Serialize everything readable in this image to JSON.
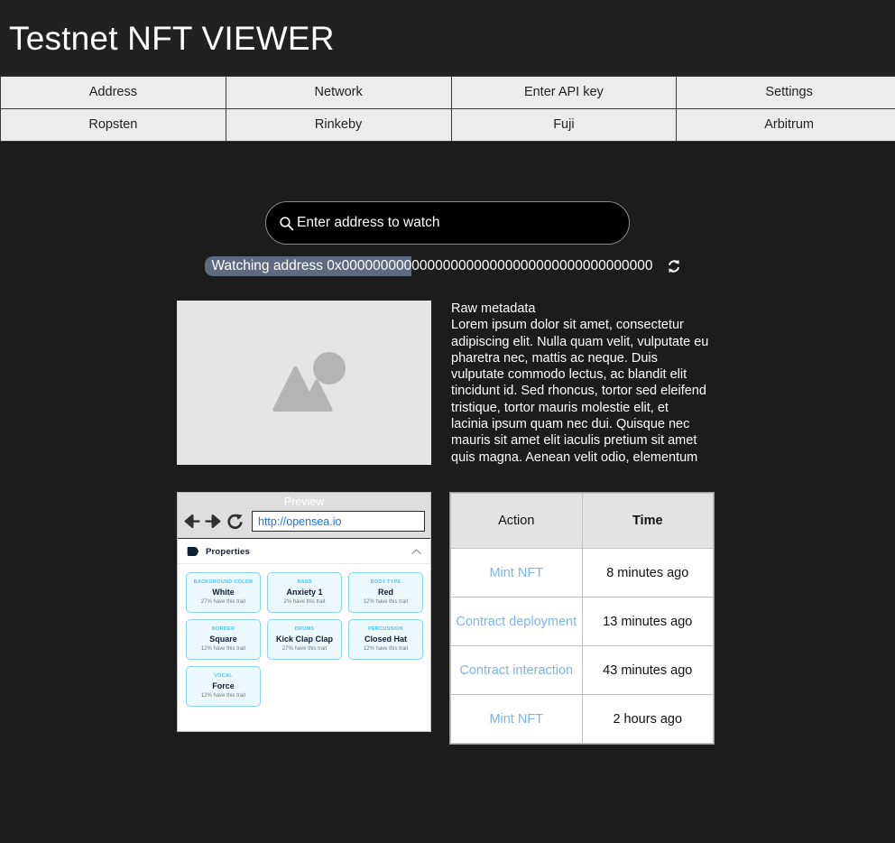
{
  "header": {
    "title": "Testnet NFT VIEWER"
  },
  "nav": {
    "row1": [
      "Address",
      "Network",
      "Enter API key",
      "Settings"
    ],
    "row2": [
      "Ropsten",
      "Rinkeby",
      "Fuji",
      "Arbitrum"
    ]
  },
  "search": {
    "placeholder": "Enter address to watch",
    "value": "",
    "icon": "search-icon"
  },
  "watching": {
    "label": "Watching address ",
    "address": "0x0000000000000000000000000000000000000000",
    "highlighted_prefix": "Watching address 0x000000000",
    "refresh_icon": "refresh-icon"
  },
  "nft": {
    "placeholder_icon": "image-placeholder-icon",
    "metadata_title": "Raw metadata",
    "metadata_body": "Lorem ipsum dolor sit amet, consectetur adipiscing elit. Nulla quam velit, vulputate eu pharetra nec, mattis ac neque. Duis vulputate commodo lectus, ac blandit elit tincidunt id. Sed rhoncus, tortor sed eleifend tristique, tortor mauris molestie elit, et lacinia ipsum quam nec dui. Quisque nec mauris sit amet elit iaculis pretium sit amet quis magna. Aenean velit odio, elementum in tempus ut, vehicula eu diam."
  },
  "preview": {
    "title": "Preview",
    "back_icon": "arrow-left-icon",
    "forward_icon": "arrow-right-icon",
    "reload_icon": "reload-icon",
    "url": "http://opensea.io",
    "properties_label": "Properties",
    "tag_icon": "tag-icon",
    "collapse_icon": "chevron-up-icon",
    "properties": [
      {
        "type": "BACKGROUND COLOR",
        "value": "White",
        "rarity": "27% have this trait"
      },
      {
        "type": "BASS",
        "value": "Anxiety 1",
        "rarity": "2% have this trait"
      },
      {
        "type": "BODY TYPE",
        "value": "Red",
        "rarity": "12% have this trait"
      },
      {
        "type": "BORDER",
        "value": "Square",
        "rarity": "12% have this trait"
      },
      {
        "type": "DRUMS",
        "value": "Kick Clap Clap",
        "rarity": "27% have this trait"
      },
      {
        "type": "PERCUSSION",
        "value": "Closed Hat",
        "rarity": "12% have this trait"
      },
      {
        "type": "VOCAL",
        "value": "Force",
        "rarity": "12% have this trait"
      }
    ]
  },
  "activity": {
    "columns": [
      "Action",
      "Time"
    ],
    "rows": [
      {
        "action": "Mint NFT",
        "time": "8 minutes ago"
      },
      {
        "action": "Contract deployment",
        "time": "13 minutes ago"
      },
      {
        "action": "Contract interaction",
        "time": "43 minutes ago"
      },
      {
        "action": "Mint NFT",
        "time": "2 hours ago"
      }
    ]
  },
  "colors": {
    "page_background": "#1c1c1c",
    "header_background": "#212121",
    "nav_background": "#ececec",
    "link_blue": "#7eb3ee",
    "url_blue": "#1a73e8",
    "trait_border": "#8ad4ef",
    "trait_fill": "#ebf8fe",
    "selection_highlight": "#5d6a80"
  }
}
